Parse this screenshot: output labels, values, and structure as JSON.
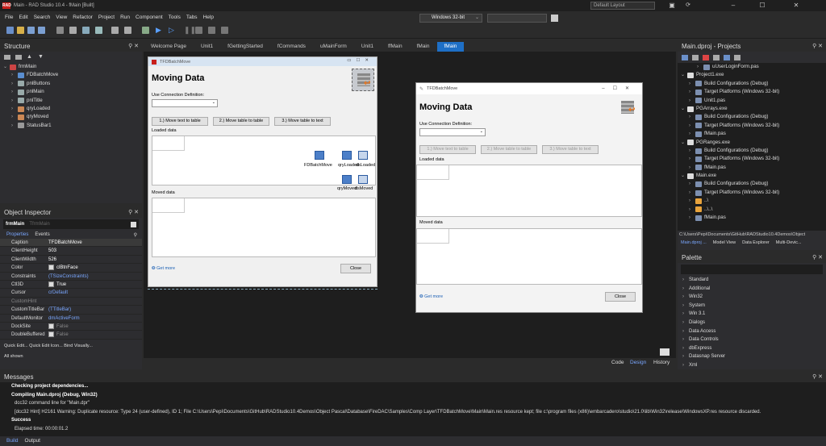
{
  "window": {
    "title": "Main - RAD Studio 10.4 - fMain [Built]",
    "layout": "Default Layout",
    "min": "–",
    "max": "☐",
    "close": "✕"
  },
  "menu": [
    "File",
    "Edit",
    "Search",
    "View",
    "Refactor",
    "Project",
    "Run",
    "Component",
    "Tools",
    "Tabs",
    "Help"
  ],
  "toolbar": {
    "platform": "Windows 32-bit"
  },
  "structure": {
    "title": "Structure",
    "items": [
      {
        "label": "frmMain",
        "indent": 0
      },
      {
        "label": "FDBatchMove",
        "indent": 1
      },
      {
        "label": "pnlButtons",
        "indent": 1
      },
      {
        "label": "pnlMain",
        "indent": 1
      },
      {
        "label": "pnlTitle",
        "indent": 1
      },
      {
        "label": "qryLoaded",
        "indent": 1
      },
      {
        "label": "qryMoved",
        "indent": 1
      },
      {
        "label": "StatusBar1",
        "indent": 1
      }
    ]
  },
  "object_inspector": {
    "title": "Object Inspector",
    "selected": "frmMain",
    "selected_type": "TfrmMain",
    "tab_properties": "Properties",
    "tab_events": "Events",
    "rows": [
      {
        "k": "Caption",
        "v": "TFDBatchMove"
      },
      {
        "k": "ClientHeight",
        "v": "503"
      },
      {
        "k": "ClientWidth",
        "v": "526"
      },
      {
        "k": "Color",
        "v": "clBtnFace"
      },
      {
        "k": "Constraints",
        "v": "(TSizeConstraints)"
      },
      {
        "k": "Ctl3D",
        "v": "True"
      },
      {
        "k": "Cursor",
        "v": "crDefault"
      },
      {
        "k": "CustomHint",
        "v": ""
      },
      {
        "k": "CustomTitleBar",
        "v": "(TTitleBar)"
      },
      {
        "k": "DefaultMonitor",
        "v": "dmActiveForm"
      },
      {
        "k": "DockSite",
        "v": "False"
      },
      {
        "k": "DoubleBuffered",
        "v": "False"
      }
    ],
    "quick": "Quick Edit...  Quick Edit Icon...  Bind Visually...",
    "all_shown": "All shown"
  },
  "editor_tabs": [
    "Welcome Page",
    "Unit1",
    "fGettingStarted",
    "fCommands",
    "uMainForm",
    "Unit1",
    "ffMain",
    "fMain",
    "fMain"
  ],
  "design_form": {
    "caption": "TFDBatchMove",
    "heading": "Moving Data",
    "conn_label": "Use Connection Definition:",
    "btn1": "1.) Move text to table",
    "btn2": "2.) Move table to table",
    "btn3": "3.) Move table to text",
    "loaded": "Loaded data",
    "moved": "Moved data",
    "get_more": "Get more",
    "close": "Close",
    "comp1": "FDBatchMove",
    "comp2": "qryLoaded",
    "comp3": "dsLoaded",
    "comp4": "qryMoved",
    "comp5": "dsMoved"
  },
  "running_form": {
    "caption": "TFDBatchMove",
    "heading": "Moving Data",
    "conn_label": "Use Connection Definition:",
    "btn1": "1.) Move text to table",
    "btn2": "2.) Move table to table",
    "btn3": "3.) Move table to text",
    "loaded": "Loaded data",
    "moved": "Moved data",
    "get_more": "Get more",
    "close": "Close"
  },
  "bottom_tabs": {
    "code": "Code",
    "design": "Design",
    "history": "History"
  },
  "projects": {
    "title": "Main.dproj - Projects",
    "items": [
      {
        "t": "uUserLoginForm.pas",
        "i": 3
      },
      {
        "t": "Project1.exe",
        "i": 1
      },
      {
        "t": "Build Configurations (Debug)",
        "i": 2
      },
      {
        "t": "Target Platforms (Windows 32-bit)",
        "i": 2
      },
      {
        "t": "Unit1.pas",
        "i": 2
      },
      {
        "t": "PGArrays.exe",
        "i": 1
      },
      {
        "t": "Build Configurations (Debug)",
        "i": 2
      },
      {
        "t": "Target Platforms (Windows 32-bit)",
        "i": 2
      },
      {
        "t": "fMain.pas",
        "i": 2
      },
      {
        "t": "PGRanges.exe",
        "i": 1
      },
      {
        "t": "Build Configurations (Debug)",
        "i": 2
      },
      {
        "t": "Target Platforms (Windows 32-bit)",
        "i": 2
      },
      {
        "t": "fMain.pas",
        "i": 2
      },
      {
        "t": "Main.exe",
        "i": 1
      },
      {
        "t": "Build Configurations (Debug)",
        "i": 2
      },
      {
        "t": "Target Platforms (Windows 32-bit)",
        "i": 2
      },
      {
        "t": "..\\",
        "i": 2
      },
      {
        "t": "..\\..\\",
        "i": 2
      },
      {
        "t": "fMain.pas",
        "i": 2
      }
    ],
    "path": "C:\\Users\\Pepi\\Documents\\GitHub\\RADStudio10.4Demos\\Object",
    "tabs": [
      "Main.dproj ...",
      "Model View",
      "Data Explorer",
      "Multi-Devic..."
    ]
  },
  "palette": {
    "title": "Palette",
    "items": [
      "Standard",
      "Additional",
      "Win32",
      "System",
      "Win 3.1",
      "Dialogs",
      "Data Access",
      "Data Controls",
      "dbExpress",
      "Datasnap Server",
      "Xml"
    ]
  },
  "messages": {
    "title": "Messages",
    "lines": [
      {
        "t": "Checking project dependencies...",
        "b": true,
        "i": 0
      },
      {
        "t": "Compiling Main.dproj (Debug, Win32)",
        "b": true,
        "i": 0
      },
      {
        "t": "dcc32 command line for \"Main.dpr\"",
        "b": false,
        "i": 1
      },
      {
        "t": "[dcc32 Hint] H2161 Warning: Duplicate resource:  Type 24 (user-defined), ID 1; File C:\\Users\\Pepi\\Documents\\GitHub\\RADStudio10.4Demos\\Object Pascal\\Database\\FireDAC\\Samples\\Comp Layer\\TFDBatchMove\\Main\\Main.res resource kept; file c:\\program files (x86)\\embarcadero\\studio\\21.0\\lib\\Win32\\release\\WindowsXP.res resource discarded.",
        "b": false,
        "i": 1
      },
      {
        "t": "Success",
        "b": true,
        "i": 0
      },
      {
        "t": "Elapsed time: 00:00:01.2",
        "b": false,
        "i": 1
      }
    ],
    "tab_build": "Build",
    "tab_output": "Output"
  }
}
